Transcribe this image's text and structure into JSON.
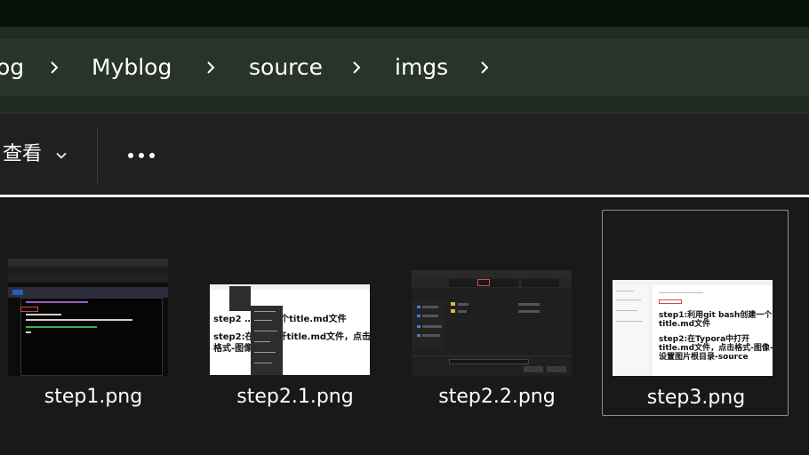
{
  "breadcrumb": {
    "items": [
      "og",
      "Myblog",
      "source",
      "imgs"
    ]
  },
  "toolbar": {
    "view_label": "查看",
    "more_icon": "more-horizontal-icon"
  },
  "colors": {
    "titlebar": "#061006",
    "address_band": "#283329",
    "toolbar": "#202020",
    "content": "#191919",
    "selection_border": "#8f8f8f"
  },
  "files": [
    {
      "name": "step1.png",
      "selected": false
    },
    {
      "name": "step2.1.png",
      "selected": false
    },
    {
      "name": "step2.2.png",
      "selected": false
    },
    {
      "name": "step3.png",
      "selected": true
    }
  ],
  "thumbnails": {
    "step2_1": {
      "line1": "step2 …创建一个title.md文件",
      "line2": "step2:在T…打开title.md文件，点击",
      "line3": "格式-图像"
    },
    "step3": {
      "line1": "step1:利用git bash创建一个",
      "line2": "title.md文件",
      "line3": "step2:在Typora中打开",
      "line4": "title.md文件，点击格式-图像-",
      "line5": "设置图片根目录-source"
    }
  }
}
